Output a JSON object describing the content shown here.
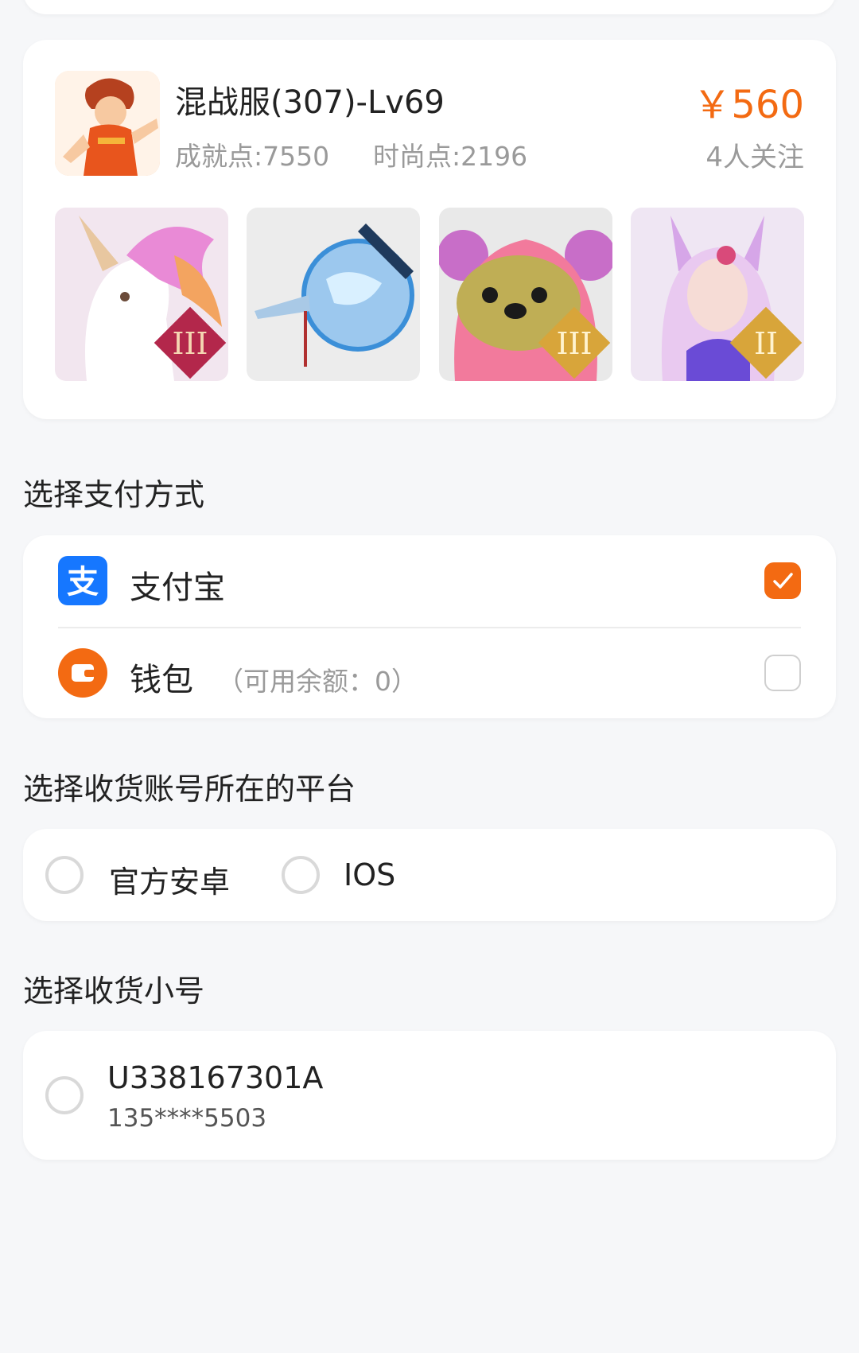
{
  "listing": {
    "title": "混战服(307)-Lv69",
    "achievement": "成就点:7550",
    "fashion": "时尚点:2196",
    "price": "￥560",
    "followers": "4人关注"
  },
  "payment": {
    "section_title": "选择支付方式",
    "options": [
      {
        "label": "支付宝",
        "note": "",
        "checked": true,
        "icon": "alipay-icon"
      },
      {
        "label": "钱包",
        "note": "（可用余额：0）",
        "checked": false,
        "icon": "wallet-icon"
      }
    ]
  },
  "platform": {
    "section_title": "选择收货账号所在的平台",
    "options": [
      {
        "label": "官方安卓",
        "selected": false
      },
      {
        "label": "IOS",
        "selected": false
      }
    ]
  },
  "account": {
    "section_title": "选择收货小号",
    "id": "U338167301A",
    "phone": "135****5503",
    "selected": false
  },
  "colors": {
    "accent": "#f36a12",
    "alipay": "#1677ff",
    "background": "#f6f7f9"
  }
}
